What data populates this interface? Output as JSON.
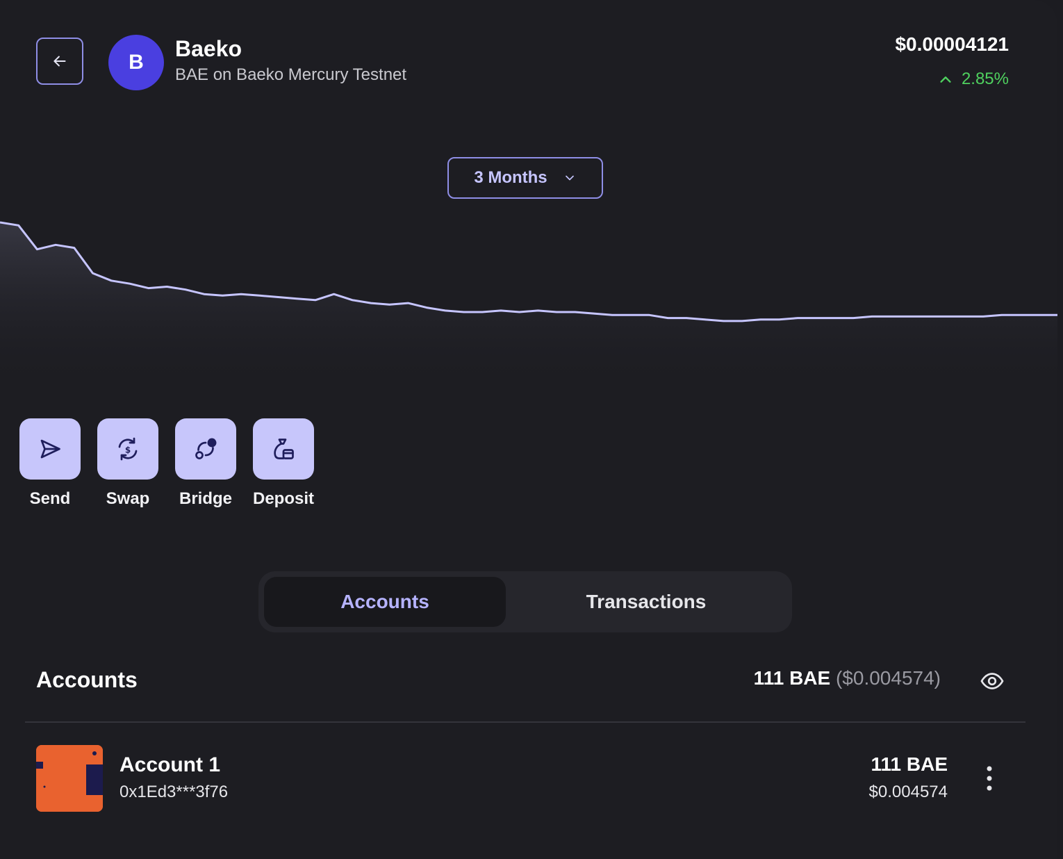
{
  "header": {
    "token_initial": "B",
    "token_name": "Baeko",
    "token_subtitle": "BAE on Baeko Mercury Testnet",
    "price": "$0.00004121",
    "change": "2.85%",
    "change_direction": "up",
    "change_color": "#4fd15f"
  },
  "range_select": {
    "value": "3 Months"
  },
  "price_chart": {
    "type": "area",
    "line_color": "#c6c5ff",
    "points": [
      1.0,
      0.98,
      0.82,
      0.85,
      0.83,
      0.66,
      0.61,
      0.59,
      0.56,
      0.57,
      0.55,
      0.52,
      0.51,
      0.52,
      0.51,
      0.5,
      0.49,
      0.48,
      0.52,
      0.48,
      0.46,
      0.45,
      0.46,
      0.43,
      0.41,
      0.4,
      0.4,
      0.41,
      0.4,
      0.41,
      0.4,
      0.4,
      0.39,
      0.38,
      0.38,
      0.38,
      0.36,
      0.36,
      0.35,
      0.34,
      0.34,
      0.35,
      0.35,
      0.36,
      0.36,
      0.36,
      0.36,
      0.37,
      0.37,
      0.37,
      0.37,
      0.37,
      0.37,
      0.37,
      0.38,
      0.38,
      0.38,
      0.38
    ]
  },
  "actions": [
    {
      "label": "Send",
      "icon": "send-icon"
    },
    {
      "label": "Swap",
      "icon": "swap-icon"
    },
    {
      "label": "Bridge",
      "icon": "bridge-icon"
    },
    {
      "label": "Deposit",
      "icon": "deposit-icon"
    }
  ],
  "tabs": [
    {
      "label": "Accounts",
      "active": true
    },
    {
      "label": "Transactions",
      "active": false
    }
  ],
  "accounts_section": {
    "title": "Accounts",
    "total_amount": "111 BAE",
    "total_usd": "($0.004574)"
  },
  "accounts": [
    {
      "name": "Account 1",
      "address": "0x1Ed3***3f76",
      "balance": "111 BAE",
      "balance_usd": "$0.004574"
    }
  ]
}
